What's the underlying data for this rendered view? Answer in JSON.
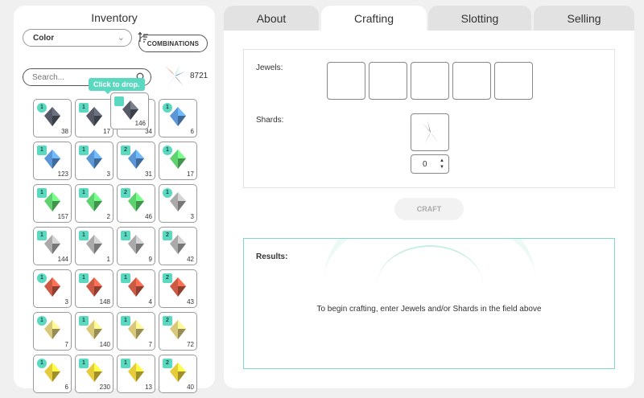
{
  "inventory": {
    "title": "Inventory",
    "filter_value": "Color",
    "combinations_label": "COMBINATIONS",
    "search_placeholder": "Search...",
    "shard_count": "8721",
    "tooltip": "Click to drop."
  },
  "dragged_item": {
    "count": "146",
    "tier": "tri"
  },
  "grid": [
    {
      "count": "38",
      "badge": "1",
      "shape": "dot",
      "color": "#555a66"
    },
    {
      "count": "17",
      "badge": "1",
      "shape": "tri",
      "color": "#555a66"
    },
    {
      "count": "34",
      "badge": "",
      "shape": "none",
      "color": "#555a66"
    },
    {
      "count": "6",
      "badge": "1",
      "shape": "dot",
      "color": "#5a96d8"
    },
    {
      "count": "123",
      "badge": "1",
      "shape": "tri",
      "color": "#5a96d8"
    },
    {
      "count": "3",
      "badge": "1",
      "shape": "star",
      "color": "#5a96d8"
    },
    {
      "count": "31",
      "badge": "2",
      "shape": "tri",
      "color": "#5a96d8"
    },
    {
      "count": "17",
      "badge": "1",
      "shape": "dot",
      "color": "#5fd270"
    },
    {
      "count": "157",
      "badge": "1",
      "shape": "tri",
      "color": "#5fd270"
    },
    {
      "count": "2",
      "badge": "1",
      "shape": "star",
      "color": "#5fd270"
    },
    {
      "count": "46",
      "badge": "2",
      "shape": "tri",
      "color": "#5fd270"
    },
    {
      "count": "3",
      "badge": "1",
      "shape": "dot",
      "color": "#aaaaaa"
    },
    {
      "count": "144",
      "badge": "1",
      "shape": "tri",
      "color": "#aaaaaa"
    },
    {
      "count": "1",
      "badge": "1",
      "shape": "tri",
      "color": "#aaaaaa"
    },
    {
      "count": "9",
      "badge": "1",
      "shape": "star",
      "color": "#aaaaaa"
    },
    {
      "count": "42",
      "badge": "2",
      "shape": "tri",
      "color": "#aaaaaa"
    },
    {
      "count": "3",
      "badge": "1",
      "shape": "dot",
      "color": "#cc5a44"
    },
    {
      "count": "148",
      "badge": "1",
      "shape": "tri",
      "color": "#cc5a44"
    },
    {
      "count": "4",
      "badge": "1",
      "shape": "star",
      "color": "#cc5a44"
    },
    {
      "count": "43",
      "badge": "2",
      "shape": "tri",
      "color": "#cc5a44"
    },
    {
      "count": "7",
      "badge": "1",
      "shape": "dot",
      "color": "#d8c878"
    },
    {
      "count": "140",
      "badge": "1",
      "shape": "tri",
      "color": "#d8c878"
    },
    {
      "count": "7",
      "badge": "1",
      "shape": "star",
      "color": "#d8c878"
    },
    {
      "count": "72",
      "badge": "2",
      "shape": "tri",
      "color": "#d8c878"
    },
    {
      "count": "6",
      "badge": "1",
      "shape": "dot",
      "color": "#e6cc3a"
    },
    {
      "count": "230",
      "badge": "1",
      "shape": "tri",
      "color": "#e6cc3a"
    },
    {
      "count": "13",
      "badge": "1",
      "shape": "star",
      "color": "#e6cc3a"
    },
    {
      "count": "40",
      "badge": "2",
      "shape": "tri",
      "color": "#e6cc3a"
    }
  ],
  "tabs": [
    {
      "label": "About",
      "active": false
    },
    {
      "label": "Crafting",
      "active": true
    },
    {
      "label": "Slotting",
      "active": false
    },
    {
      "label": "Selling",
      "active": false
    }
  ],
  "crafting": {
    "jewels_label": "Jewels:",
    "shards_label": "Shards:",
    "shard_quantity": "0",
    "craft_label": "CRAFT",
    "results_label": "Results:",
    "results_message": "To begin crafting, enter Jewels and/or Shards in the field above"
  },
  "colors": {
    "accent": "#5bd8c0",
    "results_border": "#7fd8c6"
  }
}
